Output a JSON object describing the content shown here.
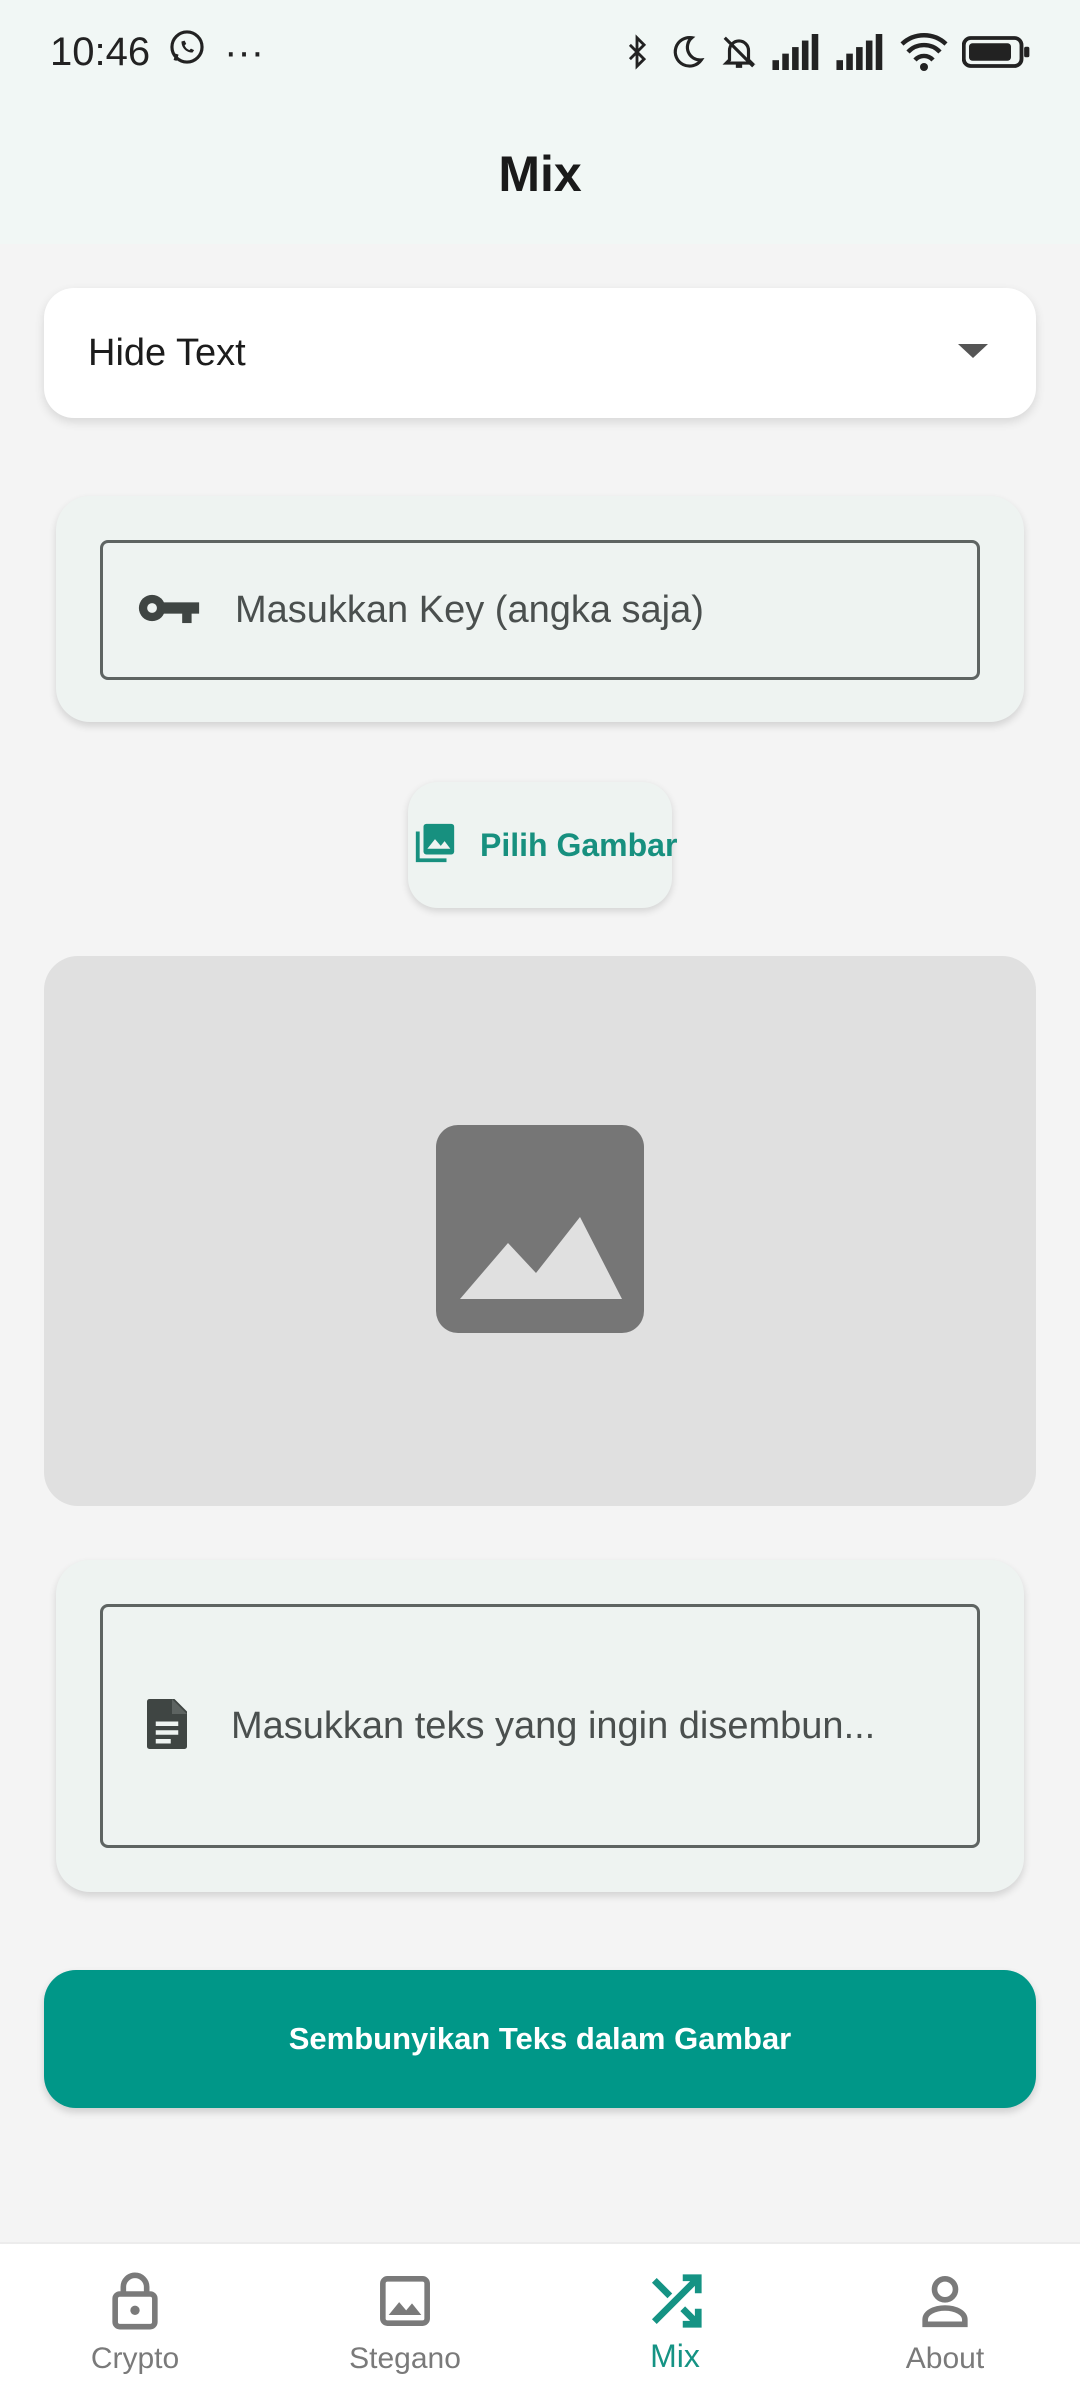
{
  "status_bar": {
    "time": "10:46",
    "overflow": "···",
    "icons": [
      "whatsapp-icon",
      "bluetooth-icon",
      "moon-icon",
      "bell-off-icon",
      "signal-icon",
      "signal-icon",
      "wifi-icon",
      "battery-icon"
    ]
  },
  "app_bar": {
    "title": "Mix"
  },
  "mode_dropdown": {
    "value": "Hide Text",
    "icon": "chevron-down-icon"
  },
  "key_field": {
    "placeholder": "Masukkan Key (angka saja)",
    "icon": "key-icon"
  },
  "pick_image": {
    "label": "Pilih Gambar",
    "icon": "photo-library-icon"
  },
  "preview": {
    "icon": "image-placeholder-icon"
  },
  "text_field": {
    "placeholder": "Masukkan teks yang ingin disembun...",
    "icon": "document-icon"
  },
  "primary_button": {
    "label": "Sembunyikan Teks dalam Gambar"
  },
  "bottom_nav": {
    "items": [
      {
        "label": "Crypto",
        "icon": "lock-icon",
        "active": false
      },
      {
        "label": "Stegano",
        "icon": "image-icon",
        "active": false
      },
      {
        "label": "Mix",
        "icon": "shuffle-icon",
        "active": true
      },
      {
        "label": "About",
        "icon": "person-icon",
        "active": false
      }
    ]
  },
  "colors": {
    "accent": "#009788",
    "accent_text": "#17907f",
    "top_background": "#f1f7f5",
    "card_background": "#eef3f1",
    "page_background": "#f4f4f4"
  }
}
